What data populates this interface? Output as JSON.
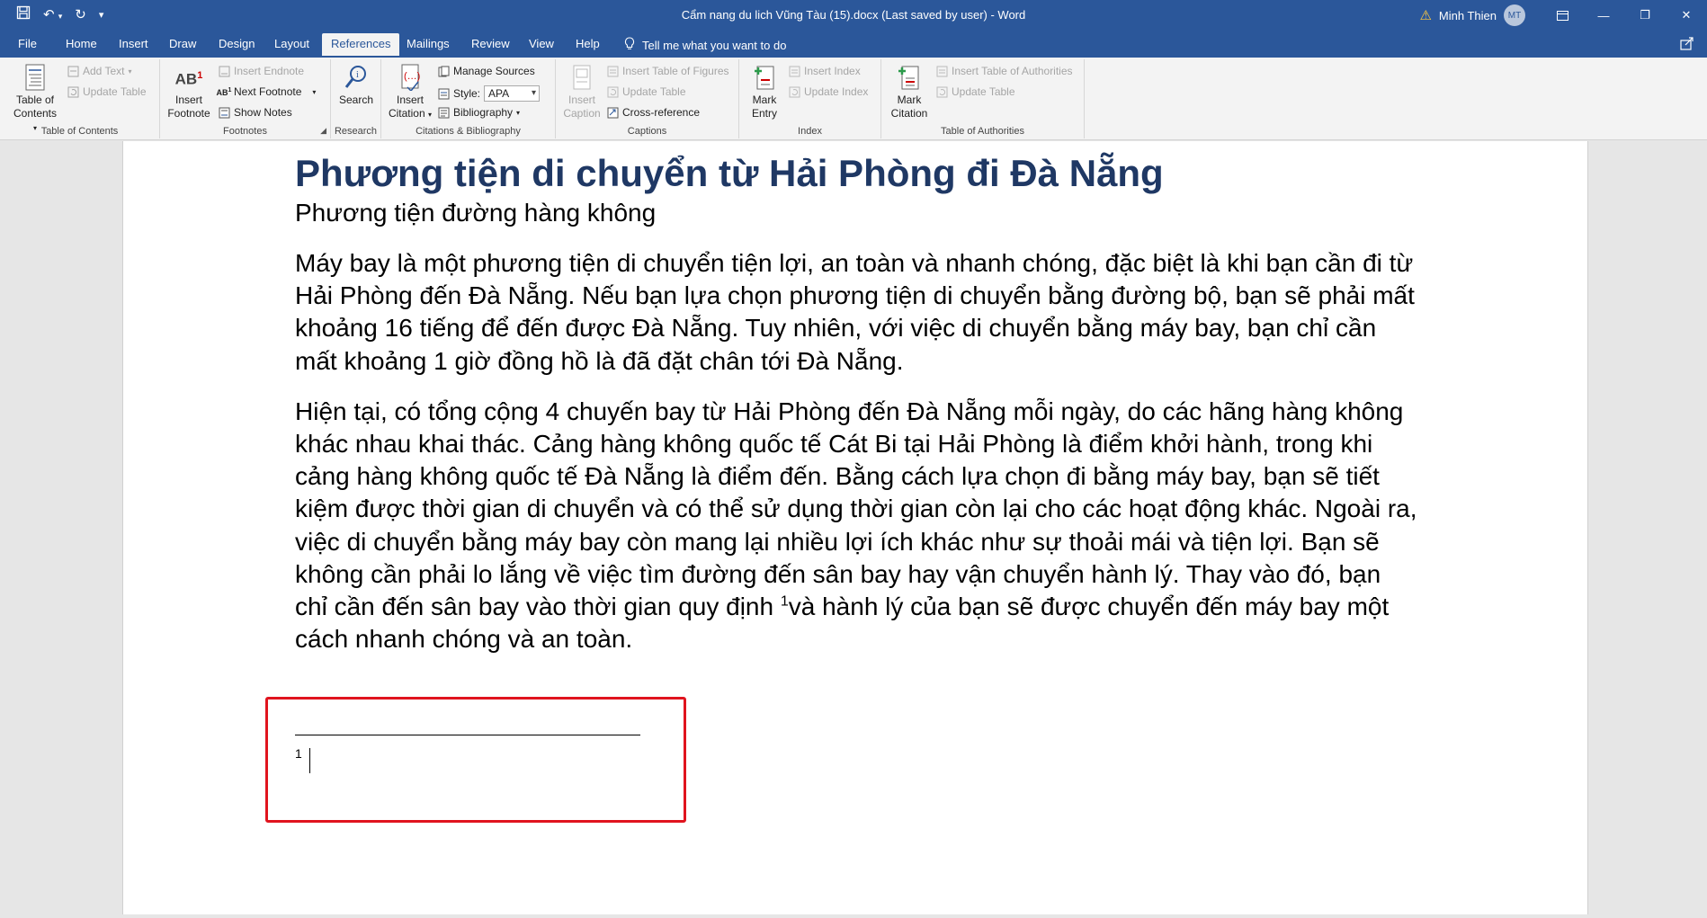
{
  "window": {
    "doc_title": "Cẩm nang du lich Vũng Tàu (15).docx (Last saved by user)  -  Word",
    "user_name": "Minh Thien",
    "user_initials": "MT"
  },
  "tabs": [
    "File",
    "Home",
    "Insert",
    "Draw",
    "Design",
    "Layout",
    "References",
    "Mailings",
    "Review",
    "View",
    "Help"
  ],
  "active_tab": "References",
  "tell_me": "Tell me what you want to do",
  "ribbon": {
    "toc": {
      "label": "Table of Contents",
      "toc_btn_line1": "Table of",
      "toc_btn_line2": "Contents",
      "add_text": "Add Text",
      "update_table": "Update Table"
    },
    "footnotes": {
      "label": "Footnotes",
      "insert_footnote_line1": "Insert",
      "insert_footnote_line2": "Footnote",
      "insert_endnote": "Insert Endnote",
      "next_footnote": "Next Footnote",
      "show_notes": "Show Notes"
    },
    "research": {
      "label": "Research",
      "search": "Search"
    },
    "citations": {
      "label": "Citations & Bibliography",
      "insert_citation_line1": "Insert",
      "insert_citation_line2": "Citation",
      "manage_sources": "Manage Sources",
      "style_label": "Style:",
      "style_value": "APA",
      "bibliography": "Bibliography"
    },
    "captions": {
      "label": "Captions",
      "insert_caption_line1": "Insert",
      "insert_caption_line2": "Caption",
      "insert_table_of_figures": "Insert Table of Figures",
      "update_table": "Update Table",
      "cross_reference": "Cross-reference"
    },
    "index": {
      "label": "Index",
      "mark_entry_line1": "Mark",
      "mark_entry_line2": "Entry",
      "insert_index": "Insert Index",
      "update_index": "Update Index"
    },
    "authorities": {
      "label": "Table of Authorities",
      "mark_citation_line1": "Mark",
      "mark_citation_line2": "Citation",
      "insert_table_of_authorities": "Insert Table of Authorities",
      "update_table": "Update Table"
    }
  },
  "document": {
    "heading1": "Phương tiện di chuyển từ Hải Phòng đi Đà Nẵng",
    "heading2": "Phương tiện đường hàng không",
    "para1": "Máy bay là một phương tiện di chuyển tiện lợi, an toàn và nhanh chóng, đặc biệt là khi bạn cần đi từ Hải Phòng đến Đà Nẵng. Nếu bạn lựa chọn phương tiện di chuyển bằng đường bộ, bạn sẽ phải mất khoảng 16 tiếng để đến được Đà Nẵng. Tuy nhiên, với việc di chuyển bằng máy bay, bạn chỉ cần mất khoảng 1 giờ đồng hồ là đã đặt chân tới Đà Nẵng.",
    "para2_before": "Hiện tại, có tổng cộng 4 chuyến bay từ Hải Phòng đến Đà Nẵng mỗi ngày, do các hãng hàng không khác nhau khai thác. Cảng hàng không quốc tế Cát Bi tại Hải Phòng là điểm khởi hành, trong khi cảng hàng không quốc tế Đà Nẵng là điểm đến. Bằng cách lựa chọn đi bằng máy bay, bạn sẽ tiết kiệm được thời gian di chuyển và có thể sử dụng thời gian còn lại cho các hoạt động khác. Ngoài ra, việc di chuyển bằng máy bay còn mang lại nhiều lợi ích khác như sự thoải mái và tiện lợi. Bạn sẽ không cần phải lo lắng về việc tìm đường đến sân bay hay vận chuyển hành lý. Thay vào đó, bạn chỉ cần đến sân bay vào thời gian quy định ",
    "footnote_ref": "1",
    "para2_after": "và hành lý của bạn sẽ được chuyển đến máy bay một cách nhanh chóng và an toàn.",
    "footnote_number": "1"
  },
  "colors": {
    "ribbon_blue": "#2b579a",
    "heading_blue": "#1f3864",
    "highlight_red": "#e0141e"
  }
}
